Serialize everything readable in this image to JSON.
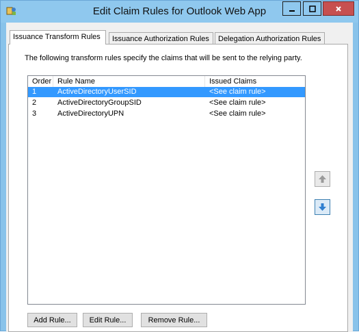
{
  "window": {
    "title": "Edit Claim Rules for Outlook Web App",
    "icon": "claim-rules-app-icon",
    "controls": {
      "minimize": "_",
      "maximize": "□",
      "close": "x"
    }
  },
  "tabs": [
    {
      "label": "Issuance Transform Rules",
      "active": true
    },
    {
      "label": "Issuance Authorization Rules",
      "active": false
    },
    {
      "label": "Delegation Authorization Rules",
      "active": false
    }
  ],
  "description": "The following transform rules specify the claims that will be sent to the relying party.",
  "table": {
    "columns": [
      "Order",
      "Rule Name",
      "Issued Claims"
    ],
    "rows": [
      {
        "order": "1",
        "name": "ActiveDirectoryUserSID",
        "claims": "<See claim rule>",
        "selected": true
      },
      {
        "order": "2",
        "name": "ActiveDirectoryGroupSID",
        "claims": "<See claim rule>",
        "selected": false
      },
      {
        "order": "3",
        "name": "ActiveDirectoryUPN",
        "claims": "<See claim rule>",
        "selected": false
      }
    ]
  },
  "side_buttons": {
    "up_icon": "arrow-up-icon",
    "down_icon": "arrow-down-icon"
  },
  "buttons": {
    "add": "Add Rule...",
    "edit": "Edit Rule...",
    "remove": "Remove Rule..."
  },
  "colors": {
    "titlebar": "#8fc8ee",
    "selection": "#3399ff",
    "close": "#c75050",
    "arrow_blue": "#2f7fd0"
  }
}
